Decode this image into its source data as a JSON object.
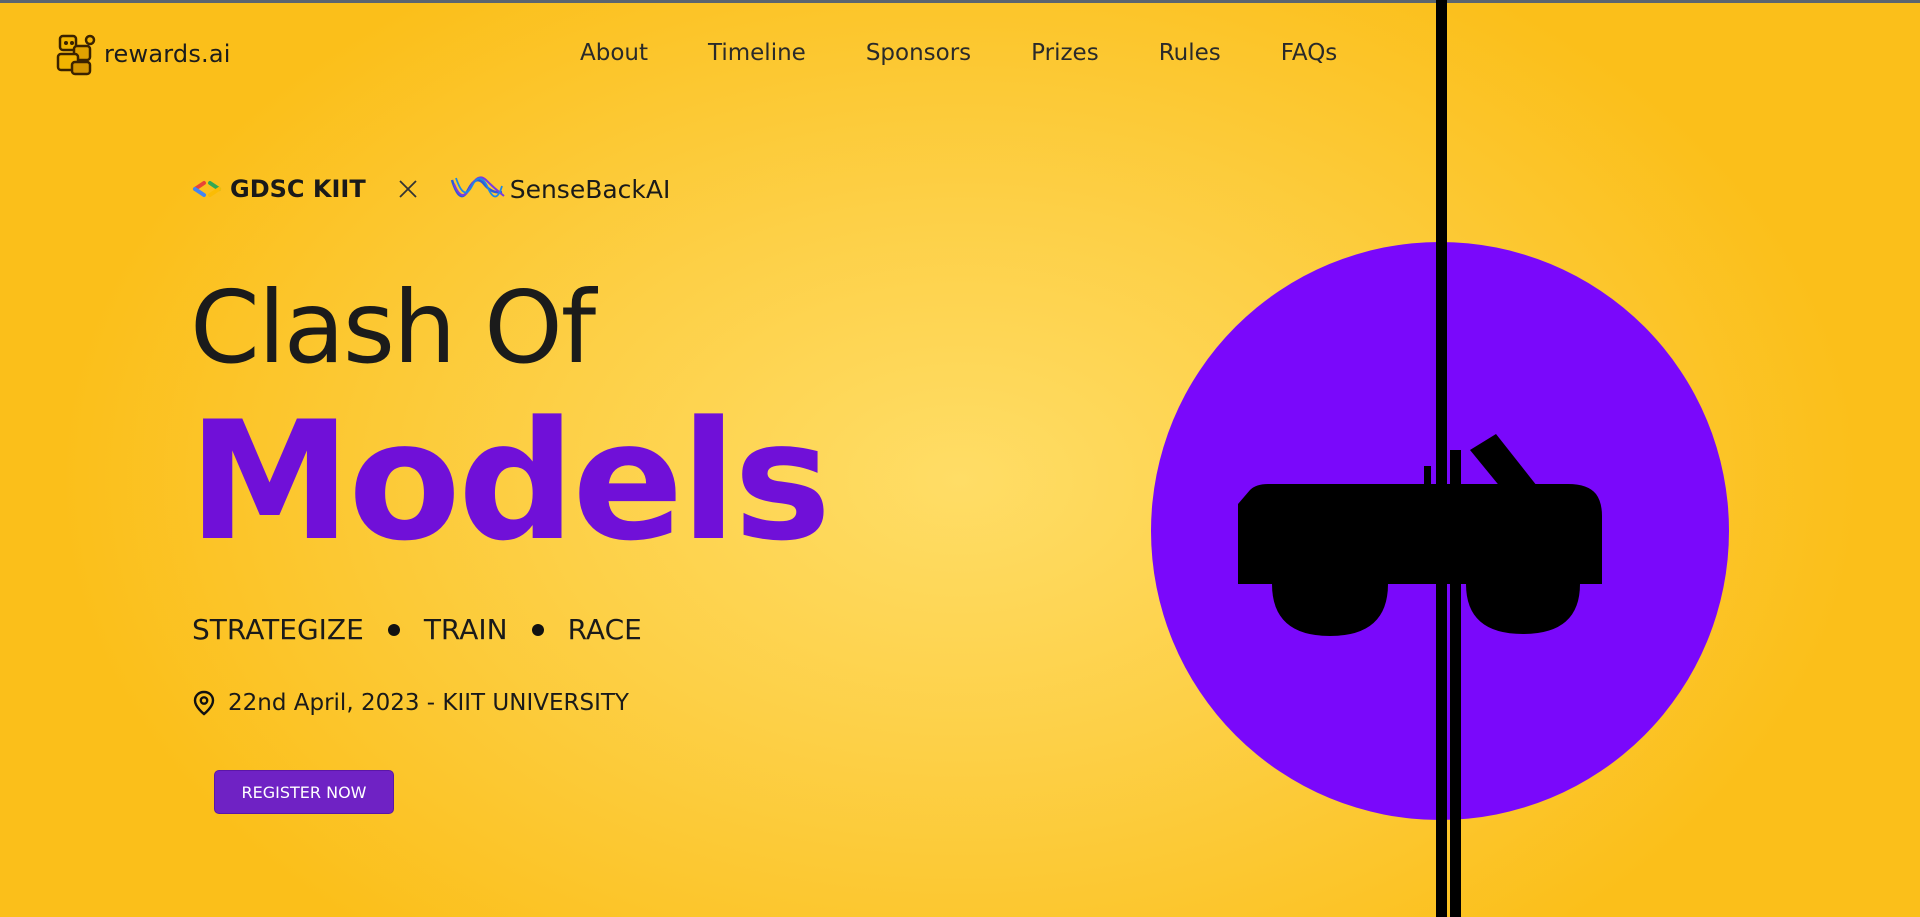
{
  "header": {
    "logo_text": "rewards.ai",
    "logo_icon": "robot-icon",
    "nav": [
      "About",
      "Timeline",
      "Sponsors",
      "Prizes",
      "Rules",
      "FAQs"
    ]
  },
  "partners": {
    "gdsc": "GDSC KIIT",
    "separator_icon": "close-icon",
    "sensebackai": "SenseBackAI"
  },
  "hero": {
    "title_line1": "Clash Of",
    "title_line2": "Models",
    "tagline": [
      "STRATEGIZE",
      "TRAIN",
      "RACE"
    ],
    "date_location": "22nd April, 2023 - KIIT UNIVERSITY",
    "register_label": "REGISTER NOW"
  },
  "colors": {
    "background": "#fbbf1a",
    "accent_purple": "#7a08fb",
    "button": "#6f22c4"
  }
}
